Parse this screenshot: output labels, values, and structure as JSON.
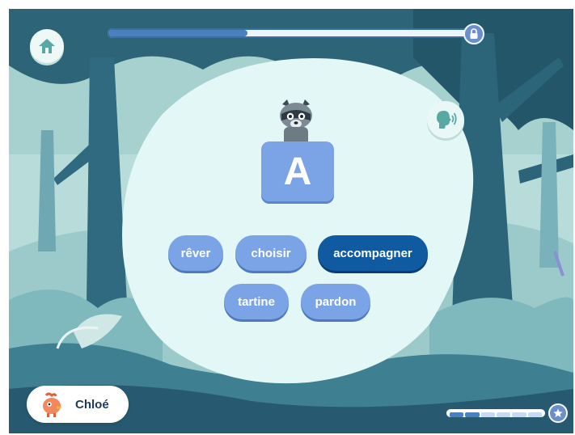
{
  "header": {
    "home_icon": "home-icon",
    "progress_fraction": 0.385,
    "lock_icon": "lock-icon"
  },
  "exercise": {
    "letter": "A",
    "sound_icon": "speaker-head-icon",
    "mascot": "raccoon",
    "words": [
      {
        "label": "rêver",
        "selected": false
      },
      {
        "label": "choisir",
        "selected": false
      },
      {
        "label": "accompagner",
        "selected": true
      },
      {
        "label": "tartine",
        "selected": false
      },
      {
        "label": "pardon",
        "selected": false
      }
    ]
  },
  "player": {
    "name": "Chloé",
    "avatar_icon": "orange-bird-avatar"
  },
  "level": {
    "segments_total": 6,
    "segments_filled": 2,
    "star_icon": "star-icon"
  },
  "colors": {
    "word_default": "#7aa4e6",
    "word_selected": "#0f5aa0",
    "bubble": "#e3f7f6",
    "forest_dark": "#2d5f78"
  }
}
